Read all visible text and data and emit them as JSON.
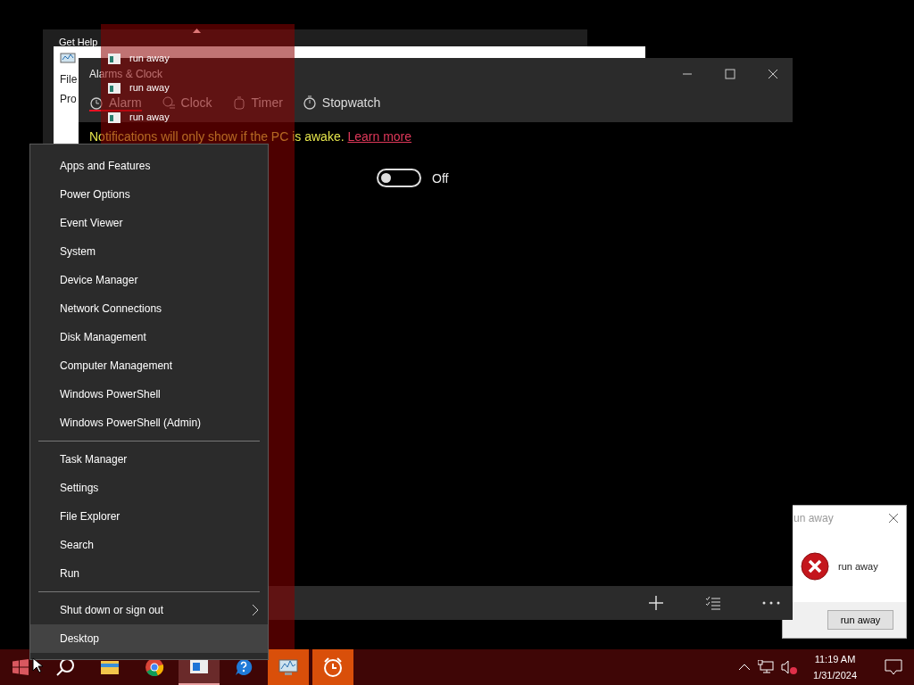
{
  "get_help_window": {
    "title": "Get Help"
  },
  "task_manager_window": {
    "menu_item": "File",
    "tab": "Pro"
  },
  "alarms_window": {
    "title": "Alarms & Clock",
    "tabs": [
      {
        "kind": "alarm",
        "label": "Alarm",
        "selected": true
      },
      {
        "kind": "clock",
        "label": "Clock",
        "selected": false
      },
      {
        "kind": "timer",
        "label": "Timer",
        "selected": false
      },
      {
        "kind": "stopwatch",
        "label": "Stopwatch",
        "selected": false
      }
    ],
    "notice": "Notifications will only show if the PC is awake.",
    "notice_link": "Learn more",
    "alarm_toggle": {
      "on": false,
      "label": "Off"
    }
  },
  "jump_list": {
    "items": [
      {
        "label": "run away"
      },
      {
        "label": "run away"
      },
      {
        "label": "run away"
      }
    ]
  },
  "message_box": {
    "title": "un away",
    "message": "run away",
    "button": "run away"
  },
  "context_menu": {
    "groups": [
      {
        "items": [
          {
            "label": "Apps and Features",
            "selected": false,
            "submenu": false
          },
          {
            "label": "Power Options",
            "selected": false,
            "submenu": false
          },
          {
            "label": "Event Viewer",
            "selected": false,
            "submenu": false
          },
          {
            "label": "System",
            "selected": false,
            "submenu": false
          },
          {
            "label": "Device Manager",
            "selected": false,
            "submenu": false
          },
          {
            "label": "Network Connections",
            "selected": false,
            "submenu": false
          },
          {
            "label": "Disk Management",
            "selected": false,
            "submenu": false
          },
          {
            "label": "Computer Management",
            "selected": false,
            "submenu": false
          },
          {
            "label": "Windows PowerShell",
            "selected": false,
            "submenu": false
          },
          {
            "label": "Windows PowerShell (Admin)",
            "selected": false,
            "submenu": false
          }
        ]
      },
      {
        "items": [
          {
            "label": "Task Manager",
            "selected": false,
            "submenu": false
          },
          {
            "label": "Settings",
            "selected": false,
            "submenu": false
          },
          {
            "label": "File Explorer",
            "selected": false,
            "submenu": false
          },
          {
            "label": "Search",
            "selected": false,
            "submenu": false
          },
          {
            "label": "Run",
            "selected": false,
            "submenu": false
          }
        ]
      },
      {
        "items": [
          {
            "label": "Shut down or sign out",
            "selected": false,
            "submenu": true
          },
          {
            "label": "Desktop",
            "selected": true,
            "submenu": false
          }
        ]
      }
    ]
  },
  "taskbar": {
    "apps": [
      {
        "kind": "explorer",
        "active": false,
        "flashing": false
      },
      {
        "kind": "chrome",
        "active": false,
        "flashing": false
      },
      {
        "kind": "window",
        "active": true,
        "flashing": false
      },
      {
        "kind": "help",
        "active": false,
        "flashing": false
      },
      {
        "kind": "monitor",
        "active": false,
        "flashing": true
      },
      {
        "kind": "alarm",
        "active": false,
        "flashing": true
      }
    ],
    "time": "11:19 AM",
    "date": "1/31/2024"
  }
}
